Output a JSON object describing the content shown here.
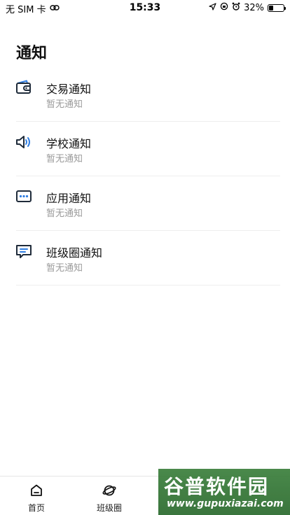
{
  "status_bar": {
    "carrier": "无 SIM 卡",
    "time": "15:33",
    "battery_percent": "32%",
    "battery_level": 0.32
  },
  "page": {
    "title": "通知"
  },
  "notifications": [
    {
      "title": "交易通知",
      "subtitle": "暂无通知",
      "icon": "wallet-icon"
    },
    {
      "title": "学校通知",
      "subtitle": "暂无通知",
      "icon": "speaker-icon"
    },
    {
      "title": "应用通知",
      "subtitle": "暂无通知",
      "icon": "message-dots-icon"
    },
    {
      "title": "班级圈通知",
      "subtitle": "暂无通知",
      "icon": "chat-icon"
    }
  ],
  "tabbar": {
    "items": [
      {
        "label": "首页",
        "icon": "home-icon"
      },
      {
        "label": "班级圈",
        "icon": "planet-icon"
      }
    ]
  },
  "watermark": {
    "logo": "谷普软件园",
    "url": "www.gupuxiazai.com"
  },
  "colors": {
    "accent": "#2f7de1",
    "icon_dark": "#1f2b3a",
    "subtitle": "#9a9a9a"
  }
}
